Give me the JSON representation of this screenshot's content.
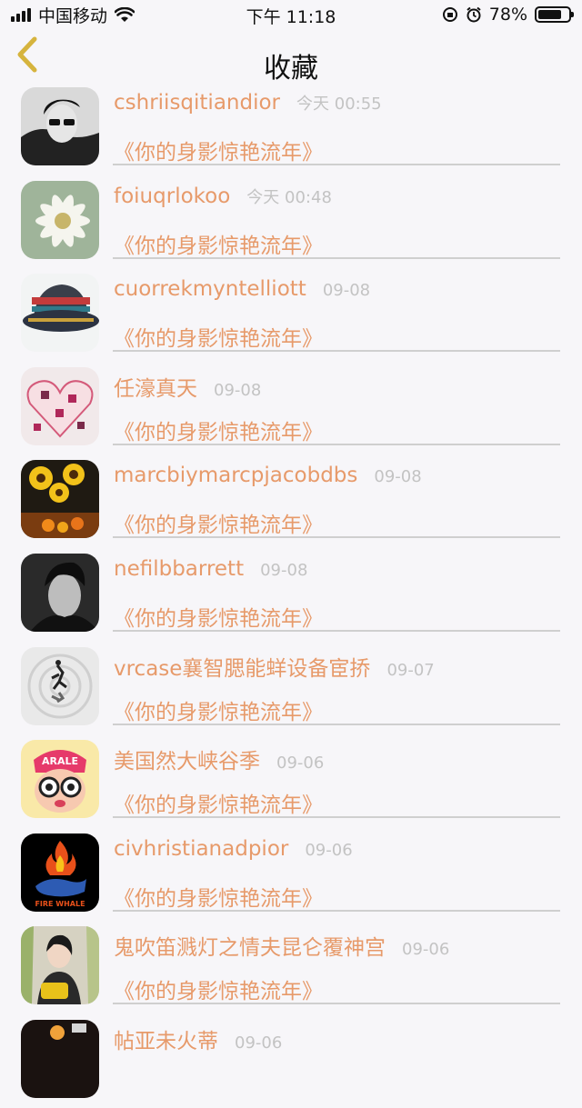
{
  "status_bar": {
    "carrier": "中国移动",
    "time": "下午 11:18",
    "battery_percent": "78%",
    "battery_level": 0.78
  },
  "nav": {
    "title": "收藏"
  },
  "favorites": [
    {
      "name": "cshriisqitiandior",
      "time": "今天 00:55",
      "content": "《你的身影惊艳流年》"
    },
    {
      "name": "foiuqrlokoo",
      "time": "今天 00:48",
      "content": "《你的身影惊艳流年》"
    },
    {
      "name": "cuorrekmyntelliott",
      "time": "09-08",
      "content": "《你的身影惊艳流年》"
    },
    {
      "name": "任濠真天",
      "time": "09-08",
      "content": "《你的身影惊艳流年》"
    },
    {
      "name": "marcbiymarcpjacobdbs",
      "time": "09-08",
      "content": "《你的身影惊艳流年》"
    },
    {
      "name": "nefilbbarrett",
      "time": "09-08",
      "content": "《你的身影惊艳流年》"
    },
    {
      "name": "vrcase襄智腮能蛘设备宦挢",
      "time": "09-07",
      "content": "《你的身影惊艳流年》"
    },
    {
      "name": "美国然大峡谷季",
      "time": "09-06",
      "content": "《你的身影惊艳流年》"
    },
    {
      "name": "civhristianadpior",
      "time": "09-06",
      "content": "《你的身影惊艳流年》"
    },
    {
      "name": "鬼吹笛溅灯之情夫昆仑覆神宫",
      "time": "09-06",
      "content": "《你的身影惊艳流年》"
    },
    {
      "name": "帖亚未火蒂",
      "time": "09-06",
      "content": ""
    }
  ],
  "avatars": {
    "fire_whale_text": "FIRE WHALE",
    "arale_text": "ARALE"
  }
}
